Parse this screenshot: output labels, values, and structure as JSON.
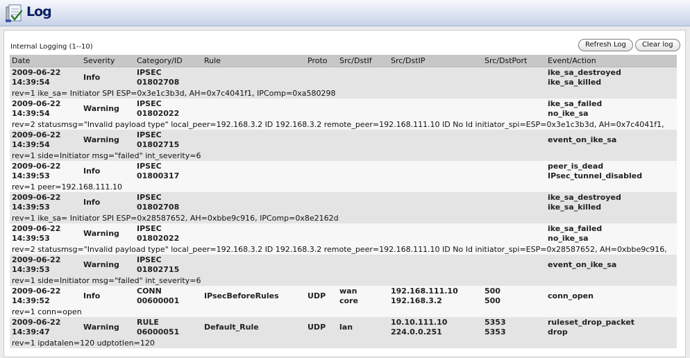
{
  "header": {
    "title": "Log"
  },
  "panel": {
    "caption": "Internal Logging (1--10)",
    "refresh_label": "Refresh Log",
    "clear_label": "Clear log"
  },
  "columns": [
    "Date",
    "Severity",
    "Category/ID",
    "Rule",
    "Proto",
    "Src/DstIf",
    "Src/DstIP",
    "Src/DstPort",
    "Event/Action"
  ],
  "rows": [
    {
      "date": "2009-06-22",
      "time": "14:39:54",
      "severity": "Info",
      "category": "IPSEC",
      "cat_id": "01802708",
      "rule": "",
      "proto": "",
      "src_if": "",
      "dst_if": "",
      "src_ip": "",
      "dst_ip": "",
      "src_port": "",
      "dst_port": "",
      "event": "ike_sa_destroyed",
      "action": "ike_sa_killed",
      "detail": "rev=1 ike_sa= Initiator SPI ESP=0x3e1c3b3d, AH=0x7c4041f1, IPComp=0xa580298"
    },
    {
      "date": "2009-06-22",
      "time": "14:39:54",
      "severity": "Warning",
      "category": "IPSEC",
      "cat_id": "01802022",
      "rule": "",
      "proto": "",
      "src_if": "",
      "dst_if": "",
      "src_ip": "",
      "dst_ip": "",
      "src_port": "",
      "dst_port": "",
      "event": "ike_sa_failed",
      "action": "no_ike_sa",
      "detail": "rev=2 statusmsg=\"Invalid payload type\" local_peer=192.168.3.2 ID 192.168.3.2 remote_peer=192.168.111.10 ID No Id initiator_spi=ESP=0x3e1c3b3d, AH=0x7c4041f1,"
    },
    {
      "date": "2009-06-22",
      "time": "14:39:54",
      "severity": "Warning",
      "category": "IPSEC",
      "cat_id": "01802715",
      "rule": "",
      "proto": "",
      "src_if": "",
      "dst_if": "",
      "src_ip": "",
      "dst_ip": "",
      "src_port": "",
      "dst_port": "",
      "event": "event_on_ike_sa",
      "action": "",
      "detail": "rev=1 side=Initiator msg=\"failed\" int_severity=6"
    },
    {
      "date": "2009-06-22",
      "time": "14:39:53",
      "severity": "Info",
      "category": "IPSEC",
      "cat_id": "01800317",
      "rule": "",
      "proto": "",
      "src_if": "",
      "dst_if": "",
      "src_ip": "",
      "dst_ip": "",
      "src_port": "",
      "dst_port": "",
      "event": "peer_is_dead",
      "action": "IPsec_tunnel_disabled",
      "detail": "rev=1 peer=192.168.111.10"
    },
    {
      "date": "2009-06-22",
      "time": "14:39:53",
      "severity": "Info",
      "category": "IPSEC",
      "cat_id": "01802708",
      "rule": "",
      "proto": "",
      "src_if": "",
      "dst_if": "",
      "src_ip": "",
      "dst_ip": "",
      "src_port": "",
      "dst_port": "",
      "event": "ike_sa_destroyed",
      "action": "ike_sa_killed",
      "detail": "rev=1 ike_sa= Initiator SPI ESP=0x28587652, AH=0xbbe9c916, IPComp=0x8e2162d"
    },
    {
      "date": "2009-06-22",
      "time": "14:39:53",
      "severity": "Warning",
      "category": "IPSEC",
      "cat_id": "01802022",
      "rule": "",
      "proto": "",
      "src_if": "",
      "dst_if": "",
      "src_ip": "",
      "dst_ip": "",
      "src_port": "",
      "dst_port": "",
      "event": "ike_sa_failed",
      "action": "no_ike_sa",
      "detail": "rev=2 statusmsg=\"Invalid payload type\" local_peer=192.168.3.2 ID 192.168.3.2 remote_peer=192.168.111.10 ID No Id initiator_spi=ESP=0x28587652, AH=0xbbe9c916,"
    },
    {
      "date": "2009-06-22",
      "time": "14:39:53",
      "severity": "Warning",
      "category": "IPSEC",
      "cat_id": "01802715",
      "rule": "",
      "proto": "",
      "src_if": "",
      "dst_if": "",
      "src_ip": "",
      "dst_ip": "",
      "src_port": "",
      "dst_port": "",
      "event": "event_on_ike_sa",
      "action": "",
      "detail": "rev=1 side=Initiator msg=\"failed\" int_severity=6"
    },
    {
      "date": "2009-06-22",
      "time": "14:39:52",
      "severity": "Info",
      "category": "CONN",
      "cat_id": "00600001",
      "rule": "IPsecBeforeRules",
      "proto": "UDP",
      "src_if": "wan",
      "dst_if": "core",
      "src_ip": "192.168.111.10",
      "dst_ip": "192.168.3.2",
      "src_port": "500",
      "dst_port": "500",
      "event": "conn_open",
      "action": "",
      "detail": "rev=1 conn=open"
    },
    {
      "date": "2009-06-22",
      "time": "14:39:47",
      "severity": "Warning",
      "category": "RULE",
      "cat_id": "06000051",
      "rule": "Default_Rule",
      "proto": "UDP",
      "src_if": "lan",
      "dst_if": "",
      "src_ip": "10.10.111.10",
      "dst_ip": "224.0.0.251",
      "src_port": "5353",
      "dst_port": "5353",
      "event": "ruleset_drop_packet",
      "action": "drop",
      "detail": "rev=1 ipdatalen=120 udptotlen=120"
    }
  ]
}
